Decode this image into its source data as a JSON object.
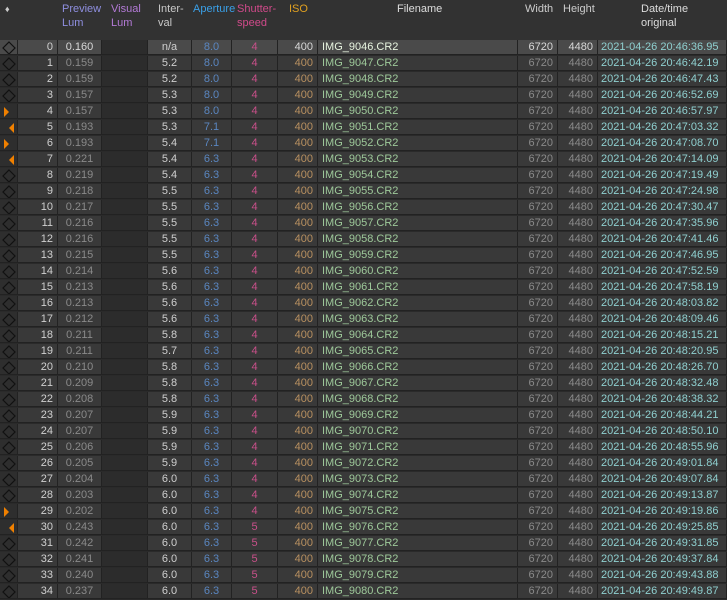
{
  "header": {
    "marker": "♦",
    "preview_lum": [
      "Preview",
      "Lum"
    ],
    "visual_lum": [
      "Visual",
      "Lum"
    ],
    "interval": [
      "Inter-",
      "val"
    ],
    "aperture": "Aperture",
    "shutter": [
      "Shutter-",
      "speed"
    ],
    "iso": "ISO",
    "filename": "Filename",
    "width": "Width",
    "height": "Height",
    "datetime": [
      "Date/time",
      "original"
    ]
  },
  "colors": {
    "preview": "#8f8fe0",
    "visual": "#b37ad6",
    "interval": "#c9c9c9",
    "aperture": "#3aa0e8",
    "shutter": "#d04a8a",
    "iso": "#e0a020",
    "marker": "#f08000"
  },
  "selected_row": 0,
  "rows": [
    {
      "i": "0",
      "m": "diamond",
      "p": "0.160",
      "iv": "n/a",
      "a": "8.0",
      "s": "4",
      "iso": "400",
      "f": "IMG_9046.CR2",
      "w": "6720",
      "h": "4480",
      "d": "2021-04-26 20:46:36.95"
    },
    {
      "i": "1",
      "m": "diamond",
      "p": "0.159",
      "iv": "5.2",
      "a": "8.0",
      "s": "4",
      "iso": "400",
      "f": "IMG_9047.CR2",
      "w": "6720",
      "h": "4480",
      "d": "2021-04-26 20:46:42.19"
    },
    {
      "i": "2",
      "m": "diamond",
      "p": "0.159",
      "iv": "5.2",
      "a": "8.0",
      "s": "4",
      "iso": "400",
      "f": "IMG_9048.CR2",
      "w": "6720",
      "h": "4480",
      "d": "2021-04-26 20:46:47.43"
    },
    {
      "i": "3",
      "m": "diamond",
      "p": "0.157",
      "iv": "5.3",
      "a": "8.0",
      "s": "4",
      "iso": "400",
      "f": "IMG_9049.CR2",
      "w": "6720",
      "h": "4480",
      "d": "2021-04-26 20:46:52.69"
    },
    {
      "i": "4",
      "m": "right",
      "p": "0.157",
      "iv": "5.3",
      "a": "8.0",
      "s": "4",
      "iso": "400",
      "f": "IMG_9050.CR2",
      "w": "6720",
      "h": "4480",
      "d": "2021-04-26 20:46:57.97"
    },
    {
      "i": "5",
      "m": "left",
      "p": "0.193",
      "iv": "5.3",
      "a": "7.1",
      "s": "4",
      "iso": "400",
      "f": "IMG_9051.CR2",
      "w": "6720",
      "h": "4480",
      "d": "2021-04-26 20:47:03.32"
    },
    {
      "i": "6",
      "m": "right",
      "p": "0.193",
      "iv": "5.4",
      "a": "7.1",
      "s": "4",
      "iso": "400",
      "f": "IMG_9052.CR2",
      "w": "6720",
      "h": "4480",
      "d": "2021-04-26 20:47:08.70"
    },
    {
      "i": "7",
      "m": "left",
      "p": "0.221",
      "iv": "5.4",
      "a": "6.3",
      "s": "4",
      "iso": "400",
      "f": "IMG_9053.CR2",
      "w": "6720",
      "h": "4480",
      "d": "2021-04-26 20:47:14.09"
    },
    {
      "i": "8",
      "m": "diamond",
      "p": "0.219",
      "iv": "5.4",
      "a": "6.3",
      "s": "4",
      "iso": "400",
      "f": "IMG_9054.CR2",
      "w": "6720",
      "h": "4480",
      "d": "2021-04-26 20:47:19.49"
    },
    {
      "i": "9",
      "m": "diamond",
      "p": "0.218",
      "iv": "5.5",
      "a": "6.3",
      "s": "4",
      "iso": "400",
      "f": "IMG_9055.CR2",
      "w": "6720",
      "h": "4480",
      "d": "2021-04-26 20:47:24.98"
    },
    {
      "i": "10",
      "m": "diamond",
      "p": "0.217",
      "iv": "5.5",
      "a": "6.3",
      "s": "4",
      "iso": "400",
      "f": "IMG_9056.CR2",
      "w": "6720",
      "h": "4480",
      "d": "2021-04-26 20:47:30.47"
    },
    {
      "i": "11",
      "m": "diamond",
      "p": "0.216",
      "iv": "5.5",
      "a": "6.3",
      "s": "4",
      "iso": "400",
      "f": "IMG_9057.CR2",
      "w": "6720",
      "h": "4480",
      "d": "2021-04-26 20:47:35.96"
    },
    {
      "i": "12",
      "m": "diamond",
      "p": "0.216",
      "iv": "5.5",
      "a": "6.3",
      "s": "4",
      "iso": "400",
      "f": "IMG_9058.CR2",
      "w": "6720",
      "h": "4480",
      "d": "2021-04-26 20:47:41.46"
    },
    {
      "i": "13",
      "m": "diamond",
      "p": "0.215",
      "iv": "5.5",
      "a": "6.3",
      "s": "4",
      "iso": "400",
      "f": "IMG_9059.CR2",
      "w": "6720",
      "h": "4480",
      "d": "2021-04-26 20:47:46.95"
    },
    {
      "i": "14",
      "m": "diamond",
      "p": "0.214",
      "iv": "5.6",
      "a": "6.3",
      "s": "4",
      "iso": "400",
      "f": "IMG_9060.CR2",
      "w": "6720",
      "h": "4480",
      "d": "2021-04-26 20:47:52.59"
    },
    {
      "i": "15",
      "m": "diamond",
      "p": "0.213",
      "iv": "5.6",
      "a": "6.3",
      "s": "4",
      "iso": "400",
      "f": "IMG_9061.CR2",
      "w": "6720",
      "h": "4480",
      "d": "2021-04-26 20:47:58.19"
    },
    {
      "i": "16",
      "m": "diamond",
      "p": "0.213",
      "iv": "5.6",
      "a": "6.3",
      "s": "4",
      "iso": "400",
      "f": "IMG_9062.CR2",
      "w": "6720",
      "h": "4480",
      "d": "2021-04-26 20:48:03.82"
    },
    {
      "i": "17",
      "m": "diamond",
      "p": "0.212",
      "iv": "5.6",
      "a": "6.3",
      "s": "4",
      "iso": "400",
      "f": "IMG_9063.CR2",
      "w": "6720",
      "h": "4480",
      "d": "2021-04-26 20:48:09.46"
    },
    {
      "i": "18",
      "m": "diamond",
      "p": "0.211",
      "iv": "5.8",
      "a": "6.3",
      "s": "4",
      "iso": "400",
      "f": "IMG_9064.CR2",
      "w": "6720",
      "h": "4480",
      "d": "2021-04-26 20:48:15.21"
    },
    {
      "i": "19",
      "m": "diamond",
      "p": "0.211",
      "iv": "5.7",
      "a": "6.3",
      "s": "4",
      "iso": "400",
      "f": "IMG_9065.CR2",
      "w": "6720",
      "h": "4480",
      "d": "2021-04-26 20:48:20.95"
    },
    {
      "i": "20",
      "m": "diamond",
      "p": "0.210",
      "iv": "5.8",
      "a": "6.3",
      "s": "4",
      "iso": "400",
      "f": "IMG_9066.CR2",
      "w": "6720",
      "h": "4480",
      "d": "2021-04-26 20:48:26.70"
    },
    {
      "i": "21",
      "m": "diamond",
      "p": "0.209",
      "iv": "5.8",
      "a": "6.3",
      "s": "4",
      "iso": "400",
      "f": "IMG_9067.CR2",
      "w": "6720",
      "h": "4480",
      "d": "2021-04-26 20:48:32.48"
    },
    {
      "i": "22",
      "m": "diamond",
      "p": "0.208",
      "iv": "5.8",
      "a": "6.3",
      "s": "4",
      "iso": "400",
      "f": "IMG_9068.CR2",
      "w": "6720",
      "h": "4480",
      "d": "2021-04-26 20:48:38.32"
    },
    {
      "i": "23",
      "m": "diamond",
      "p": "0.207",
      "iv": "5.9",
      "a": "6.3",
      "s": "4",
      "iso": "400",
      "f": "IMG_9069.CR2",
      "w": "6720",
      "h": "4480",
      "d": "2021-04-26 20:48:44.21"
    },
    {
      "i": "24",
      "m": "diamond",
      "p": "0.207",
      "iv": "5.9",
      "a": "6.3",
      "s": "4",
      "iso": "400",
      "f": "IMG_9070.CR2",
      "w": "6720",
      "h": "4480",
      "d": "2021-04-26 20:48:50.10"
    },
    {
      "i": "25",
      "m": "diamond",
      "p": "0.206",
      "iv": "5.9",
      "a": "6.3",
      "s": "4",
      "iso": "400",
      "f": "IMG_9071.CR2",
      "w": "6720",
      "h": "4480",
      "d": "2021-04-26 20:48:55.96"
    },
    {
      "i": "26",
      "m": "diamond",
      "p": "0.205",
      "iv": "5.9",
      "a": "6.3",
      "s": "4",
      "iso": "400",
      "f": "IMG_9072.CR2",
      "w": "6720",
      "h": "4480",
      "d": "2021-04-26 20:49:01.84"
    },
    {
      "i": "27",
      "m": "diamond",
      "p": "0.204",
      "iv": "6.0",
      "a": "6.3",
      "s": "4",
      "iso": "400",
      "f": "IMG_9073.CR2",
      "w": "6720",
      "h": "4480",
      "d": "2021-04-26 20:49:07.84"
    },
    {
      "i": "28",
      "m": "diamond",
      "p": "0.203",
      "iv": "6.0",
      "a": "6.3",
      "s": "4",
      "iso": "400",
      "f": "IMG_9074.CR2",
      "w": "6720",
      "h": "4480",
      "d": "2021-04-26 20:49:13.87"
    },
    {
      "i": "29",
      "m": "right",
      "p": "0.202",
      "iv": "6.0",
      "a": "6.3",
      "s": "4",
      "iso": "400",
      "f": "IMG_9075.CR2",
      "w": "6720",
      "h": "4480",
      "d": "2021-04-26 20:49:19.86"
    },
    {
      "i": "30",
      "m": "left",
      "p": "0.243",
      "iv": "6.0",
      "a": "6.3",
      "s": "5",
      "iso": "400",
      "f": "IMG_9076.CR2",
      "w": "6720",
      "h": "4480",
      "d": "2021-04-26 20:49:25.85"
    },
    {
      "i": "31",
      "m": "diamond",
      "p": "0.242",
      "iv": "6.0",
      "a": "6.3",
      "s": "5",
      "iso": "400",
      "f": "IMG_9077.CR2",
      "w": "6720",
      "h": "4480",
      "d": "2021-04-26 20:49:31.85"
    },
    {
      "i": "32",
      "m": "diamond",
      "p": "0.241",
      "iv": "6.0",
      "a": "6.3",
      "s": "5",
      "iso": "400",
      "f": "IMG_9078.CR2",
      "w": "6720",
      "h": "4480",
      "d": "2021-04-26 20:49:37.84"
    },
    {
      "i": "33",
      "m": "diamond",
      "p": "0.240",
      "iv": "6.0",
      "a": "6.3",
      "s": "5",
      "iso": "400",
      "f": "IMG_9079.CR2",
      "w": "6720",
      "h": "4480",
      "d": "2021-04-26 20:49:43.88"
    },
    {
      "i": "34",
      "m": "diamond",
      "p": "0.237",
      "iv": "6.0",
      "a": "6.3",
      "s": "5",
      "iso": "400",
      "f": "IMG_9080.CR2",
      "w": "6720",
      "h": "4480",
      "d": "2021-04-26 20:49:49.87"
    }
  ]
}
